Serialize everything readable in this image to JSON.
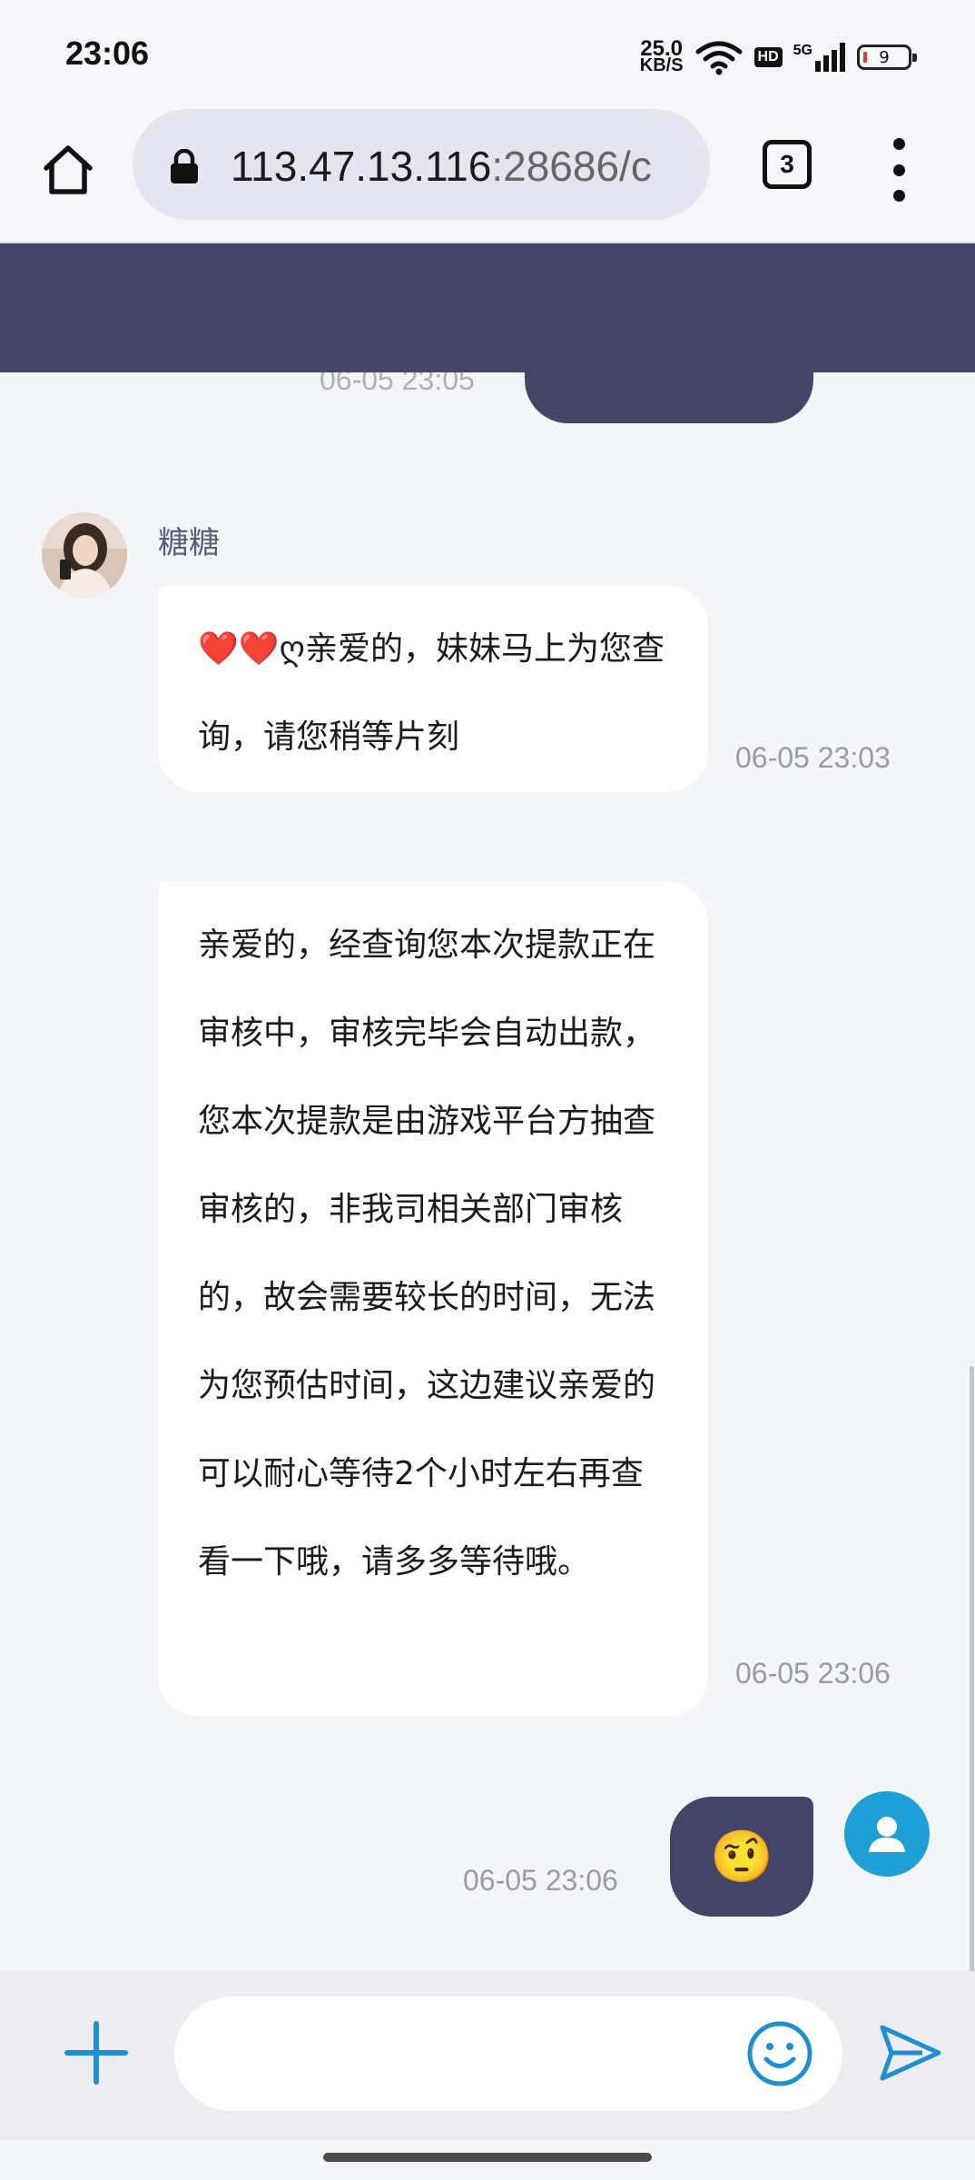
{
  "status_bar": {
    "time": "23:06",
    "net_speed_value": "25.0",
    "net_speed_unit": "KB/S",
    "hd_label": "HD",
    "network_label": "5G",
    "battery": "9"
  },
  "browser": {
    "url_host": "113.47.13.116",
    "url_rest": ":28686/c",
    "tab_count": "3"
  },
  "chat": {
    "partial_time": "06-05 23:05",
    "messages": [
      {
        "sender": "糖糖",
        "text": "❤️❤️ღ亲爱的，妹妹马上为您查询，请您稍等片刻",
        "time": "06-05 23:03"
      },
      {
        "text": "亲爱的，经查询您本次提款正在审核中，审核完毕会自动出款，您本次提款是由游戏平台方抽查审核的，非我司相关部门审核的，故会需要较长的时间，无法为您预估时间，这边建议亲爱的可以耐心等待2个小时左右再查看一下哦，请多多等待哦。",
        "time": "06-05 23:06"
      },
      {
        "emoji": "🤨",
        "time": "06-05 23:06"
      }
    ]
  },
  "composer": {
    "input_value": "",
    "input_placeholder": ""
  },
  "colors": {
    "header": "#434467",
    "accent_blue": "#1e9fd6",
    "bubble_in": "#ffffff",
    "bubble_out": "#434467"
  }
}
